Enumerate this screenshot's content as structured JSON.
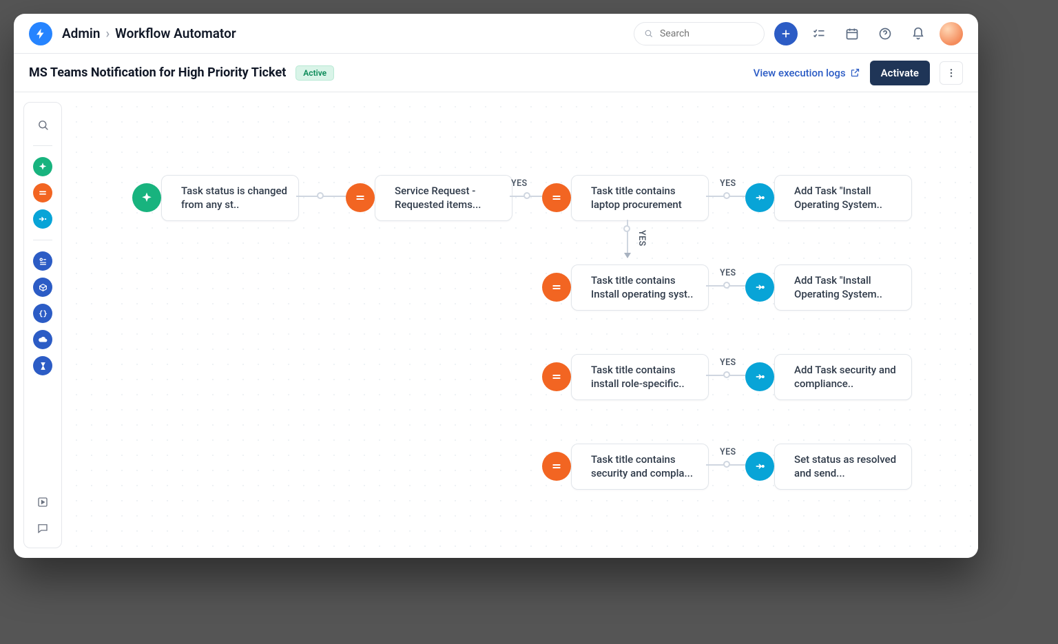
{
  "header": {
    "breadcrumb_parent": "Admin",
    "breadcrumb_current": "Workflow Automator",
    "search_placeholder": "Search"
  },
  "subheader": {
    "workflow_title": "MS Teams Notification for High Priority Ticket",
    "status_pill": "Active",
    "logs_link": "View execution logs",
    "activate_label": "Activate"
  },
  "nodes": {
    "trigger": "Task status is changed from any st..",
    "cond1": "Service Request - Requested items...",
    "cond2": "Task title contains laptop procurement",
    "act2": "Add Task \"Install Operating System..",
    "cond3": "Task title contains Install operating syst..",
    "act3": "Add Task \"Install Operating System..",
    "cond4": "Task title contains install role-specific..",
    "act4": "Add Task security and compliance..",
    "cond5": "Task title contains security and compla...",
    "act5": "Set status as resolved and send..."
  },
  "labels": {
    "yes": "YES"
  },
  "rail": {
    "search": "search",
    "event": "event",
    "condition": "condition",
    "action": "action",
    "app1": "app-form",
    "app2": "app-package",
    "app3": "app-json",
    "app4": "app-cloud",
    "app5": "app-timer",
    "help": "help",
    "feedback": "feedback"
  }
}
